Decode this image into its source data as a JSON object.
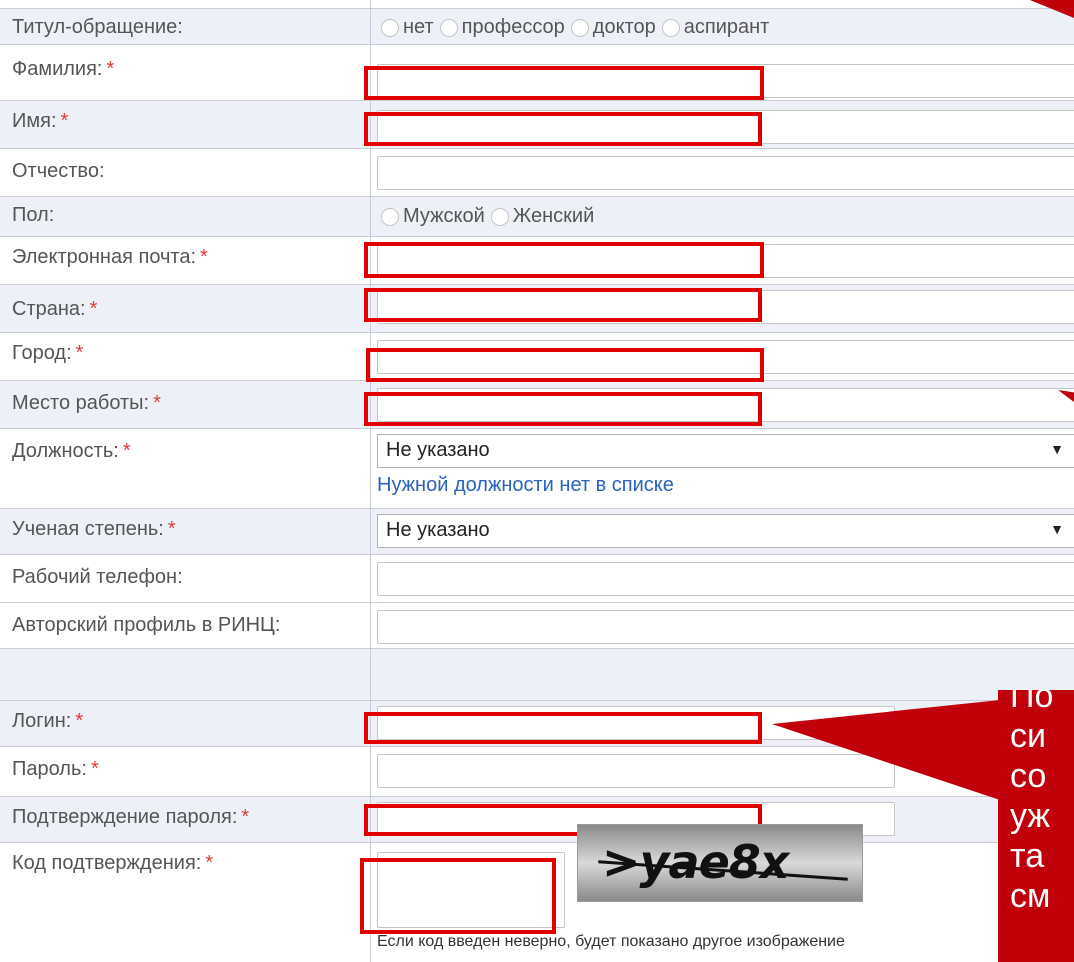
{
  "form": {
    "title_label": "Титул-обращение:",
    "title_options": [
      "нет",
      "профессор",
      "доктор",
      "аспирант"
    ],
    "lastname_label": "Фамилия:",
    "firstname_label": "Имя:",
    "middlename_label": "Отчество:",
    "gender_label": "Пол:",
    "gender_options": [
      "Мужской",
      "Женский"
    ],
    "email_label": "Электронная почта:",
    "country_label": "Страна:",
    "city_label": "Город:",
    "workplace_label": "Место работы:",
    "position_label": "Должность:",
    "position_value": "Не указано",
    "position_link": "Нужной должности нет в списке",
    "degree_label": "Ученая степень:",
    "degree_value": "Не указано",
    "phone_label": "Рабочий телефон:",
    "rinc_label": "Авторский профиль в РИНЦ:",
    "login_label": "Логин:",
    "password_label": "Пароль:",
    "password_confirm_label": "Подтверждение пароля:",
    "captcha_label": "Код подтверждения:",
    "captcha_text": ">yae8x",
    "captcha_note": "Если код введен неверно, будет показано другое изображение",
    "required_mark": "*"
  },
  "callout": {
    "lines": [
      "По",
      "си",
      "со",
      "уж",
      "та",
      "см"
    ]
  },
  "colors": {
    "highlight_red": "#e00000",
    "callout_red": "#c0000a",
    "row_alt": "#eef0f8",
    "link_blue": "#2a62c0",
    "required_red": "#e03a3a"
  }
}
